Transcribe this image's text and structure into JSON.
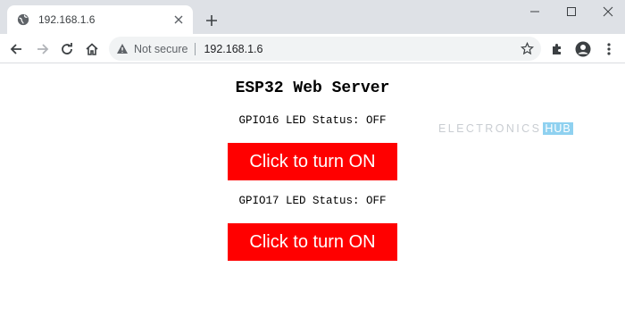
{
  "browser": {
    "tab": {
      "title": "192.168.1.6",
      "favicon": "globe-icon"
    },
    "new_tab_icon": "plus-icon",
    "window_controls": [
      "minimize-icon",
      "maximize-icon",
      "close-icon"
    ],
    "toolbar_icons": [
      "back-arrow-icon",
      "forward-arrow-icon",
      "reload-icon",
      "home-icon",
      "star-icon",
      "extensions-puzzle-icon",
      "profile-avatar-icon",
      "more-menu-icon"
    ],
    "omnibox": {
      "security_label": "Not secure",
      "url": "192.168.1.6"
    }
  },
  "page": {
    "title": "ESP32 Web Server",
    "gpio16": {
      "status_text": "GPIO16 LED Status: OFF",
      "button_label": "Click to turn ON"
    },
    "gpio17": {
      "status_text": "GPIO17 LED Status: OFF",
      "button_label": "Click to turn ON"
    },
    "watermark": {
      "text": "ELECTRONICS",
      "badge": "HUB"
    }
  },
  "colors": {
    "button_bg": "#ff0000",
    "button_text": "#ffffff",
    "tabstrip_bg": "#dee1e6",
    "omnibox_bg": "#f1f3f4",
    "watermark_accent": "#8fd1f0"
  }
}
